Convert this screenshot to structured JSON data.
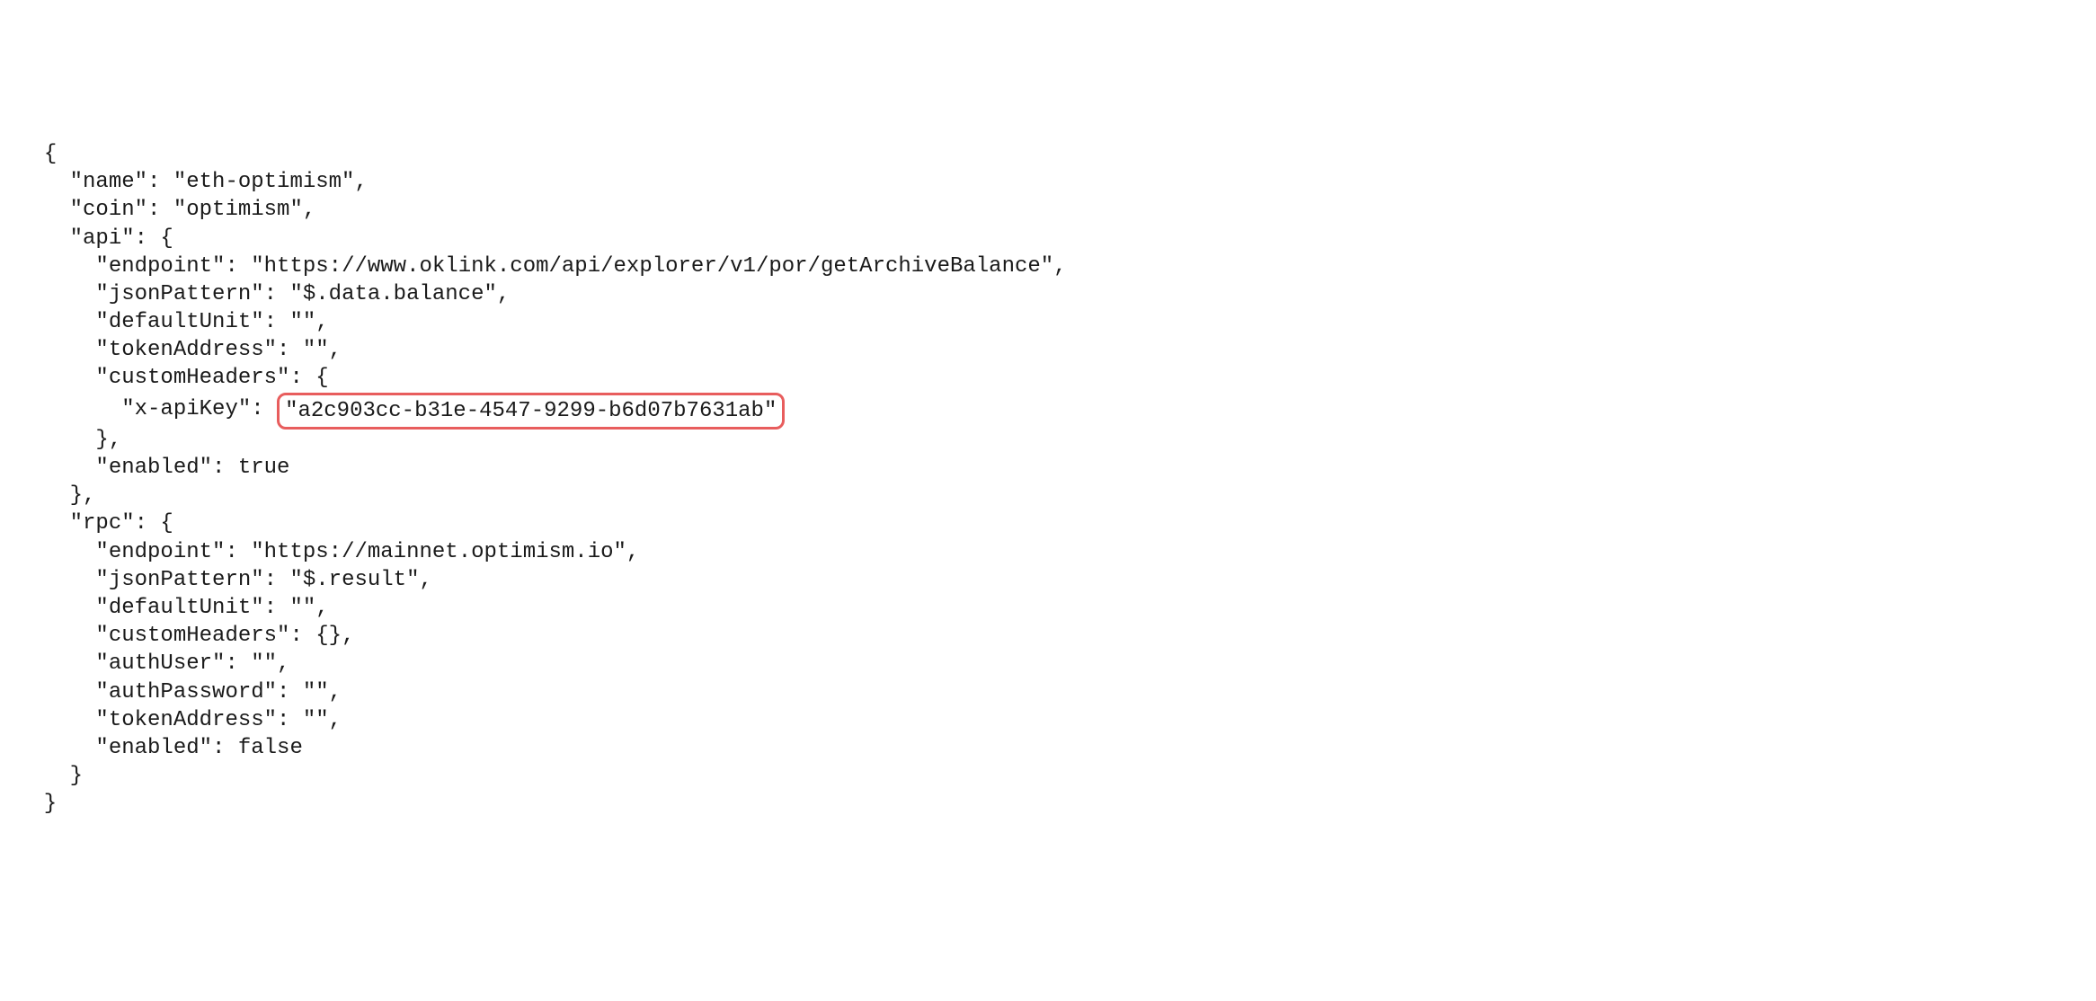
{
  "lines": {
    "l1": "{",
    "l2_prefix": "    \"name\": ",
    "l2_val": "\"eth-optimism\"",
    "l2_suffix": ",",
    "l3_prefix": "    \"coin\": ",
    "l3_val": "\"optimism\"",
    "l3_suffix": ",",
    "l4_prefix": "    \"api\": {",
    "l5_prefix": "      \"endpoint\": ",
    "l5_val": "\"https://www.oklink.com/api/explorer/v1/por/getArchiveBalance\"",
    "l5_suffix": ",",
    "l6_prefix": "      \"jsonPattern\": ",
    "l6_val": "\"$.data.balance\"",
    "l6_suffix": ",",
    "l7_prefix": "      \"defaultUnit\": ",
    "l7_val": "\"\"",
    "l7_suffix": ",",
    "l8_prefix": "      \"tokenAddress\": ",
    "l8_val": "\"\"",
    "l8_suffix": ",",
    "l9": "      \"customHeaders\": {",
    "l10_prefix": "        \"x-apiKey\":",
    "l10_val": "\"a2c903cc-b31e-4547-9299-b6d07b7631ab\"",
    "l11": "      },",
    "l12_prefix": "      \"enabled\": ",
    "l12_val": "true",
    "l13": "    },",
    "l14": "    \"rpc\": {",
    "l15_prefix": "      \"endpoint\": ",
    "l15_val": "\"https://mainnet.optimism.io\"",
    "l15_suffix": ",",
    "l16_prefix": "      \"jsonPattern\": ",
    "l16_val": "\"$.result\"",
    "l16_suffix": ",",
    "l17_prefix": "      \"defaultUnit\": ",
    "l17_val": "\"\"",
    "l17_suffix": ",",
    "l18_prefix": "      \"customHeaders\": ",
    "l18_val": "{}",
    "l18_suffix": ",",
    "l19_prefix": "      \"authUser\": ",
    "l19_val": "\"\"",
    "l19_suffix": ",",
    "l20_prefix": "      \"authPassword\": ",
    "l20_val": "\"\"",
    "l20_suffix": ",",
    "l21_prefix": "      \"tokenAddress\": ",
    "l21_val": "\"\"",
    "l21_suffix": ",",
    "l22_prefix": "      \"enabled\": ",
    "l22_val": "false",
    "l23": "    }",
    "l24": "  }"
  },
  "highlight_color": "#e85d5d"
}
